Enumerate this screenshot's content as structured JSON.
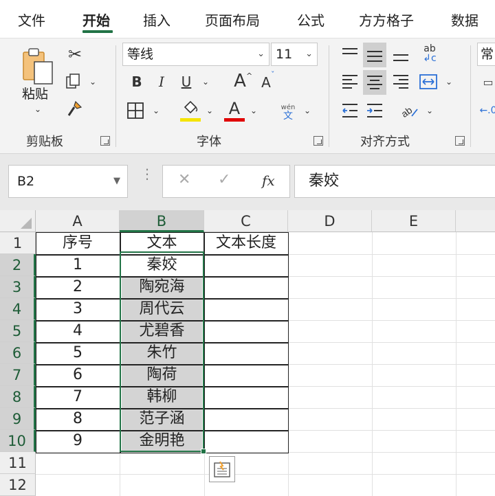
{
  "tabs": [
    "文件",
    "开始",
    "插入",
    "页面布局",
    "公式",
    "方方格子",
    "数据"
  ],
  "active_tab": "开始",
  "ribbon": {
    "clipboard": {
      "paste_label": "粘贴",
      "group_label": "剪贴板"
    },
    "font": {
      "font_name": "等线",
      "font_size": "11",
      "bold": "B",
      "italic": "I",
      "underline": "U",
      "grow": "A",
      "shrink": "A",
      "font_color_letter": "A",
      "phonetic_top": "wén",
      "phonetic_bottom": "文",
      "group_label": "字体",
      "highlight_color": "#f5e400",
      "font_color": "#e00000"
    },
    "alignment": {
      "group_label": "对齐方式"
    },
    "cut_off_label": "常"
  },
  "formula_bar": {
    "name_box": "B2",
    "fx": "fx",
    "content": "秦姣"
  },
  "columns": [
    "A",
    "B",
    "C",
    "D",
    "E"
  ],
  "rows": [
    "1",
    "2",
    "3",
    "4",
    "5",
    "6",
    "7",
    "8",
    "9",
    "10",
    "11",
    "12"
  ],
  "cells": {
    "A1": "序号",
    "B1": "文本",
    "C1": "文本长度",
    "A2": "1",
    "B2": "秦姣",
    "A3": "2",
    "B3": "陶宛海",
    "A4": "3",
    "B4": "周代云",
    "A5": "4",
    "B5": "尤碧香",
    "A6": "5",
    "B6": "朱竹",
    "A7": "6",
    "B7": "陶荷",
    "A8": "7",
    "B8": "韩柳",
    "A9": "8",
    "B9": "范子涵",
    "A10": "9",
    "B10": "金明艳"
  },
  "colors": {
    "accent": "#217346",
    "selection_fill": "#d4d4d4"
  }
}
